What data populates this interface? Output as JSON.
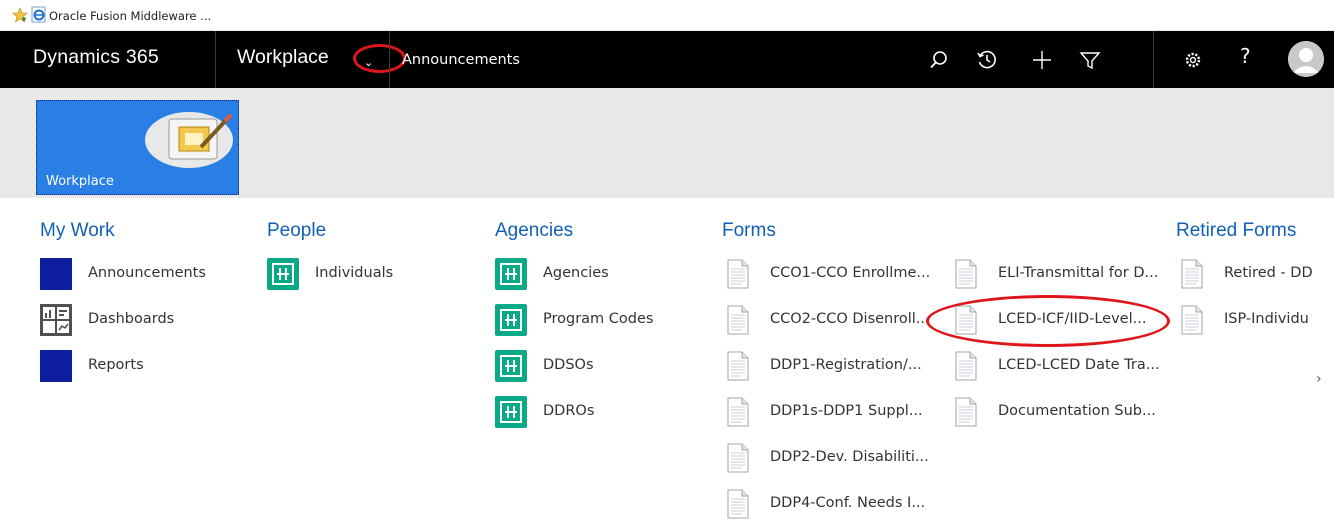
{
  "browser": {
    "favorite_label": "Oracle Fusion Middleware ..."
  },
  "nav": {
    "brand": "Dynamics 365",
    "area": "Workplace",
    "area_chevron": "⌄",
    "breadcrumb": "Announcements",
    "icons": [
      "search-icon",
      "recent-icon",
      "new-icon",
      "filter-icon",
      "settings-icon",
      "help-icon",
      "user-avatar"
    ],
    "help_label": "?"
  },
  "area_tile": {
    "label": "Workplace",
    "color": "#2a7fe5"
  },
  "sitemap": {
    "my_work": {
      "title": "My Work",
      "items": [
        {
          "label": "Announcements",
          "icon": "blue-square-icon"
        },
        {
          "label": "Dashboards",
          "icon": "dashboard-icon"
        },
        {
          "label": "Reports",
          "icon": "blue-square-icon"
        }
      ]
    },
    "people": {
      "title": "People",
      "items": [
        {
          "label": "Individuals",
          "icon": "entity-icon"
        }
      ]
    },
    "agencies": {
      "title": "Agencies",
      "items": [
        {
          "label": "Agencies",
          "icon": "entity-icon"
        },
        {
          "label": "Program Codes",
          "icon": "entity-icon"
        },
        {
          "label": "DDSOs",
          "icon": "entity-icon"
        },
        {
          "label": "DDROs",
          "icon": "entity-icon"
        }
      ]
    },
    "forms": {
      "title": "Forms",
      "column1": [
        {
          "label": "CCO1-CCO Enrollme..."
        },
        {
          "label": "CCO2-CCO Disenroll..."
        },
        {
          "label": "DDP1-Registration/..."
        },
        {
          "label": "DDP1s-DDP1 Suppl..."
        },
        {
          "label": "DDP2-Dev. Disabiliti..."
        },
        {
          "label": "DDP4-Conf. Needs I..."
        }
      ],
      "column2": [
        {
          "label": "ELI-Transmittal for D..."
        },
        {
          "label": "LCED-ICF/IID-Level..."
        },
        {
          "label": "LCED-LCED Date Tra..."
        },
        {
          "label": "Documentation Sub..."
        }
      ]
    },
    "retired_forms": {
      "title": "Retired Forms",
      "items": [
        {
          "label": "Retired - DD"
        },
        {
          "label": "ISP-Individu"
        }
      ]
    },
    "next_arrow": "›"
  },
  "colors": {
    "nav_bg": "#000000",
    "group_title": "#1160b7",
    "annotation": "#e0151a",
    "entity_green": "#09a886",
    "dark_blue": "#0d1fa0"
  }
}
